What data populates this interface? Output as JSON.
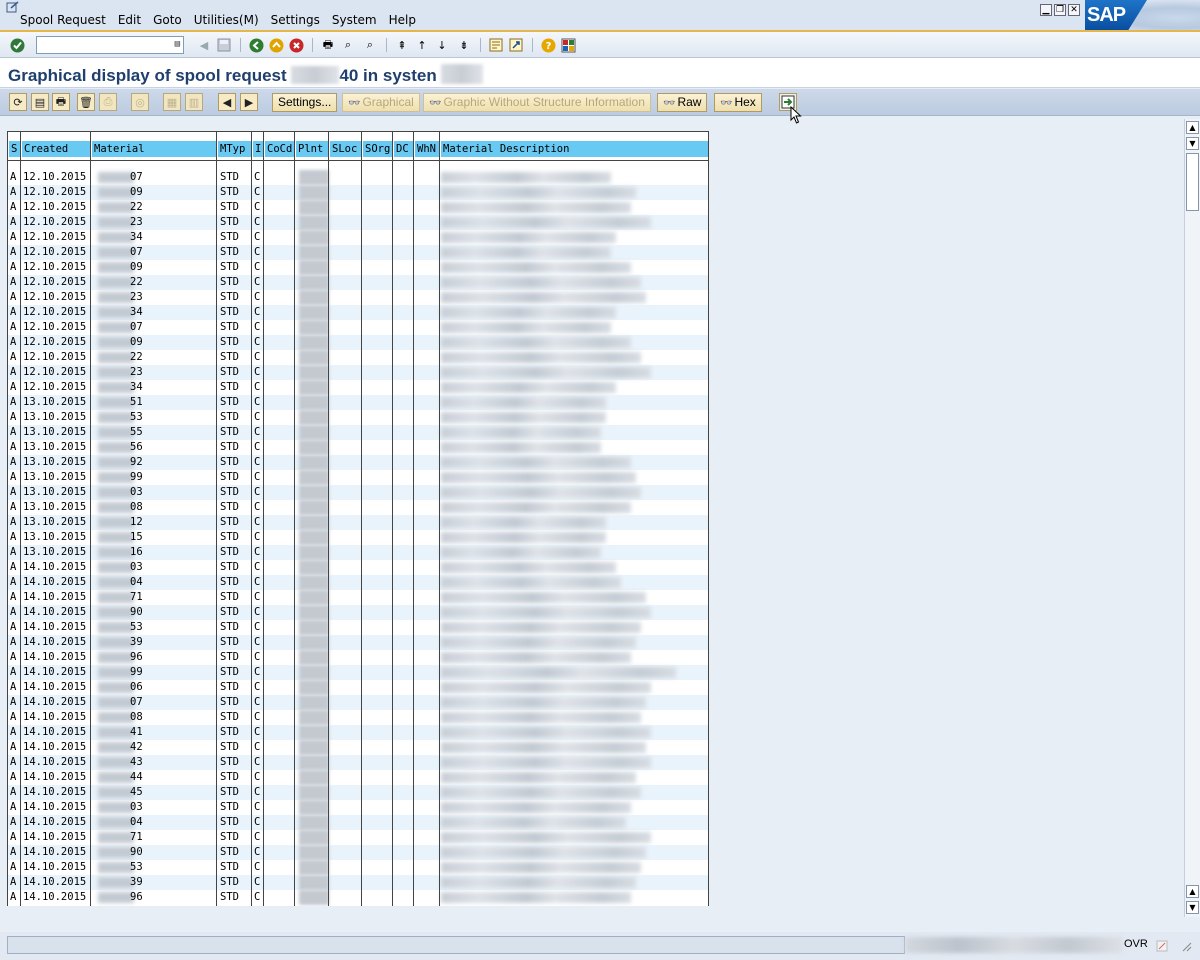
{
  "menubar": {
    "items": [
      "Spool Request",
      "Edit",
      "Goto",
      "Utilities(M)",
      "Settings",
      "System",
      "Help"
    ],
    "logo_text": "SAP"
  },
  "stdbar": {
    "command_value": ""
  },
  "title": {
    "prefix": "Graphical display of spool request",
    "request_suffix": "40 in systen"
  },
  "apptoolbar": {
    "settings_label": "Settings...",
    "graphical_label": "Graphical",
    "graphic_wo_label": "Graphic Without Structure Information",
    "raw_label": "Raw",
    "hex_label": "Hex"
  },
  "grid": {
    "headers": [
      "S",
      "Created",
      "Material",
      "MTyp",
      "I",
      "CoCd",
      "Plnt",
      "SLoc",
      "SOrg",
      "DC",
      "WhN",
      "Material Description"
    ],
    "rows": [
      {
        "s": "A",
        "created": "12.10.2015",
        "mat": "07",
        "mtyp": "STD",
        "i": "C",
        "desc": 170
      },
      {
        "s": "A",
        "created": "12.10.2015",
        "mat": "09",
        "mtyp": "STD",
        "i": "C",
        "desc": 195
      },
      {
        "s": "A",
        "created": "12.10.2015",
        "mat": "22",
        "mtyp": "STD",
        "i": "C",
        "desc": 190
      },
      {
        "s": "A",
        "created": "12.10.2015",
        "mat": "23",
        "mtyp": "STD",
        "i": "C",
        "desc": 210
      },
      {
        "s": "A",
        "created": "12.10.2015",
        "mat": "34",
        "mtyp": "STD",
        "i": "C",
        "desc": 175
      },
      {
        "s": "A",
        "created": "12.10.2015",
        "mat": "07",
        "mtyp": "STD",
        "i": "C",
        "desc": 170
      },
      {
        "s": "A",
        "created": "12.10.2015",
        "mat": "09",
        "mtyp": "STD",
        "i": "C",
        "desc": 190
      },
      {
        "s": "A",
        "created": "12.10.2015",
        "mat": "22",
        "mtyp": "STD",
        "i": "C",
        "desc": 200
      },
      {
        "s": "A",
        "created": "12.10.2015",
        "mat": "23",
        "mtyp": "STD",
        "i": "C",
        "desc": 205
      },
      {
        "s": "A",
        "created": "12.10.2015",
        "mat": "34",
        "mtyp": "STD",
        "i": "C",
        "desc": 175
      },
      {
        "s": "A",
        "created": "12.10.2015",
        "mat": "07",
        "mtyp": "STD",
        "i": "C",
        "desc": 170
      },
      {
        "s": "A",
        "created": "12.10.2015",
        "mat": "09",
        "mtyp": "STD",
        "i": "C",
        "desc": 190
      },
      {
        "s": "A",
        "created": "12.10.2015",
        "mat": "22",
        "mtyp": "STD",
        "i": "C",
        "desc": 200
      },
      {
        "s": "A",
        "created": "12.10.2015",
        "mat": "23",
        "mtyp": "STD",
        "i": "C",
        "desc": 210
      },
      {
        "s": "A",
        "created": "12.10.2015",
        "mat": "34",
        "mtyp": "STD",
        "i": "C",
        "desc": 175
      },
      {
        "s": "A",
        "created": "13.10.2015",
        "mat": "51",
        "mtyp": "STD",
        "i": "C",
        "desc": 165
      },
      {
        "s": "A",
        "created": "13.10.2015",
        "mat": "53",
        "mtyp": "STD",
        "i": "C",
        "desc": 165
      },
      {
        "s": "A",
        "created": "13.10.2015",
        "mat": "55",
        "mtyp": "STD",
        "i": "C",
        "desc": 160
      },
      {
        "s": "A",
        "created": "13.10.2015",
        "mat": "56",
        "mtyp": "STD",
        "i": "C",
        "desc": 160
      },
      {
        "s": "A",
        "created": "13.10.2015",
        "mat": "92",
        "mtyp": "STD",
        "i": "C",
        "desc": 190
      },
      {
        "s": "A",
        "created": "13.10.2015",
        "mat": "99",
        "mtyp": "STD",
        "i": "C",
        "desc": 195
      },
      {
        "s": "A",
        "created": "13.10.2015",
        "mat": "03",
        "mtyp": "STD",
        "i": "C",
        "desc": 200
      },
      {
        "s": "A",
        "created": "13.10.2015",
        "mat": "08",
        "mtyp": "STD",
        "i": "C",
        "desc": 190
      },
      {
        "s": "A",
        "created": "13.10.2015",
        "mat": "12",
        "mtyp": "STD",
        "i": "C",
        "desc": 165
      },
      {
        "s": "A",
        "created": "13.10.2015",
        "mat": "15",
        "mtyp": "STD",
        "i": "C",
        "desc": 165
      },
      {
        "s": "A",
        "created": "13.10.2015",
        "mat": "16",
        "mtyp": "STD",
        "i": "C",
        "desc": 160
      },
      {
        "s": "A",
        "created": "14.10.2015",
        "mat": "03",
        "mtyp": "STD",
        "i": "C",
        "desc": 175
      },
      {
        "s": "A",
        "created": "14.10.2015",
        "mat": "04",
        "mtyp": "STD",
        "i": "C",
        "desc": 180
      },
      {
        "s": "A",
        "created": "14.10.2015",
        "mat": "71",
        "mtyp": "STD",
        "i": "C",
        "desc": 205
      },
      {
        "s": "A",
        "created": "14.10.2015",
        "mat": "90",
        "mtyp": "STD",
        "i": "C",
        "desc": 210
      },
      {
        "s": "A",
        "created": "14.10.2015",
        "mat": "53",
        "mtyp": "STD",
        "i": "C",
        "desc": 200
      },
      {
        "s": "A",
        "created": "14.10.2015",
        "mat": "39",
        "mtyp": "STD",
        "i": "C",
        "desc": 195
      },
      {
        "s": "A",
        "created": "14.10.2015",
        "mat": "96",
        "mtyp": "STD",
        "i": "C",
        "desc": 190
      },
      {
        "s": "A",
        "created": "14.10.2015",
        "mat": "99",
        "mtyp": "STD",
        "i": "C",
        "desc": 235
      },
      {
        "s": "A",
        "created": "14.10.2015",
        "mat": "06",
        "mtyp": "STD",
        "i": "C",
        "desc": 210
      },
      {
        "s": "A",
        "created": "14.10.2015",
        "mat": "07",
        "mtyp": "STD",
        "i": "C",
        "desc": 205
      },
      {
        "s": "A",
        "created": "14.10.2015",
        "mat": "08",
        "mtyp": "STD",
        "i": "C",
        "desc": 200
      },
      {
        "s": "A",
        "created": "14.10.2015",
        "mat": "41",
        "mtyp": "STD",
        "i": "C",
        "desc": 210
      },
      {
        "s": "A",
        "created": "14.10.2015",
        "mat": "42",
        "mtyp": "STD",
        "i": "C",
        "desc": 205
      },
      {
        "s": "A",
        "created": "14.10.2015",
        "mat": "43",
        "mtyp": "STD",
        "i": "C",
        "desc": 210
      },
      {
        "s": "A",
        "created": "14.10.2015",
        "mat": "44",
        "mtyp": "STD",
        "i": "C",
        "desc": 195
      },
      {
        "s": "A",
        "created": "14.10.2015",
        "mat": "45",
        "mtyp": "STD",
        "i": "C",
        "desc": 200
      },
      {
        "s": "A",
        "created": "14.10.2015",
        "mat": "03",
        "mtyp": "STD",
        "i": "C",
        "desc": 190
      },
      {
        "s": "A",
        "created": "14.10.2015",
        "mat": "04",
        "mtyp": "STD",
        "i": "C",
        "desc": 185
      },
      {
        "s": "A",
        "created": "14.10.2015",
        "mat": "71",
        "mtyp": "STD",
        "i": "C",
        "desc": 210
      },
      {
        "s": "A",
        "created": "14.10.2015",
        "mat": "90",
        "mtyp": "STD",
        "i": "C",
        "desc": 205
      },
      {
        "s": "A",
        "created": "14.10.2015",
        "mat": "53",
        "mtyp": "STD",
        "i": "C",
        "desc": 200
      },
      {
        "s": "A",
        "created": "14.10.2015",
        "mat": "39",
        "mtyp": "STD",
        "i": "C",
        "desc": 195
      },
      {
        "s": "A",
        "created": "14.10.2015",
        "mat": "96",
        "mtyp": "STD",
        "i": "C",
        "desc": 190
      }
    ]
  },
  "statusbar": {
    "mode": "OVR"
  }
}
